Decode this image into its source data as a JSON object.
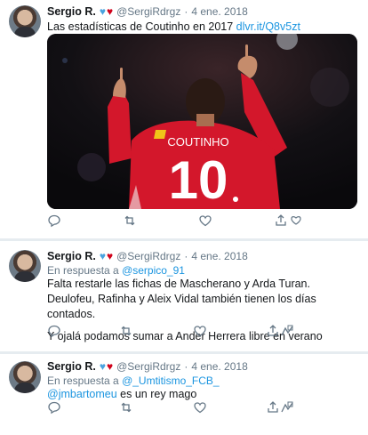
{
  "tweets": [
    {
      "name": "Sergio R.",
      "handle": "@SergiRdrgz",
      "dot": "·",
      "date": "4 ene. 2018",
      "text": "Las estadísticas de Coutinho en 2017",
      "link": "dlvr.it/Q8v5zt",
      "media": {
        "jersey_name": "COUTINHO",
        "jersey_number": "10"
      }
    },
    {
      "name": "Sergio R.",
      "handle": "@SergiRdrgz",
      "dot": "·",
      "date": "4 ene. 2018",
      "reply_prefix": "En respuesta a",
      "reply_to": "@serpico_91",
      "text_1": "Falta restarle las fichas de Mascherano y Arda Turan. Deulofeu, Rafinha y Aleix Vidal también tienen los días contados.",
      "text_2": "Y ojalá podamos sumar a Ander Herrera libre en verano"
    },
    {
      "name": "Sergio R.",
      "handle": "@SergiRdrgz",
      "dot": "·",
      "date": "4 ene. 2018",
      "reply_prefix": "En respuesta a",
      "reply_to": "@_Umtitismo_FCB_",
      "mention": "@jmbartomeu",
      "text": "es un rey mago"
    }
  ],
  "icons": [
    "reply-icon",
    "retweet-icon",
    "like-icon",
    "share-icon",
    "heart-badge-blue",
    "heart-badge-red"
  ],
  "colors": {
    "link": "#1b95e0",
    "muted": "#657786",
    "icon": "#657786",
    "background": "#e6ecf0"
  }
}
